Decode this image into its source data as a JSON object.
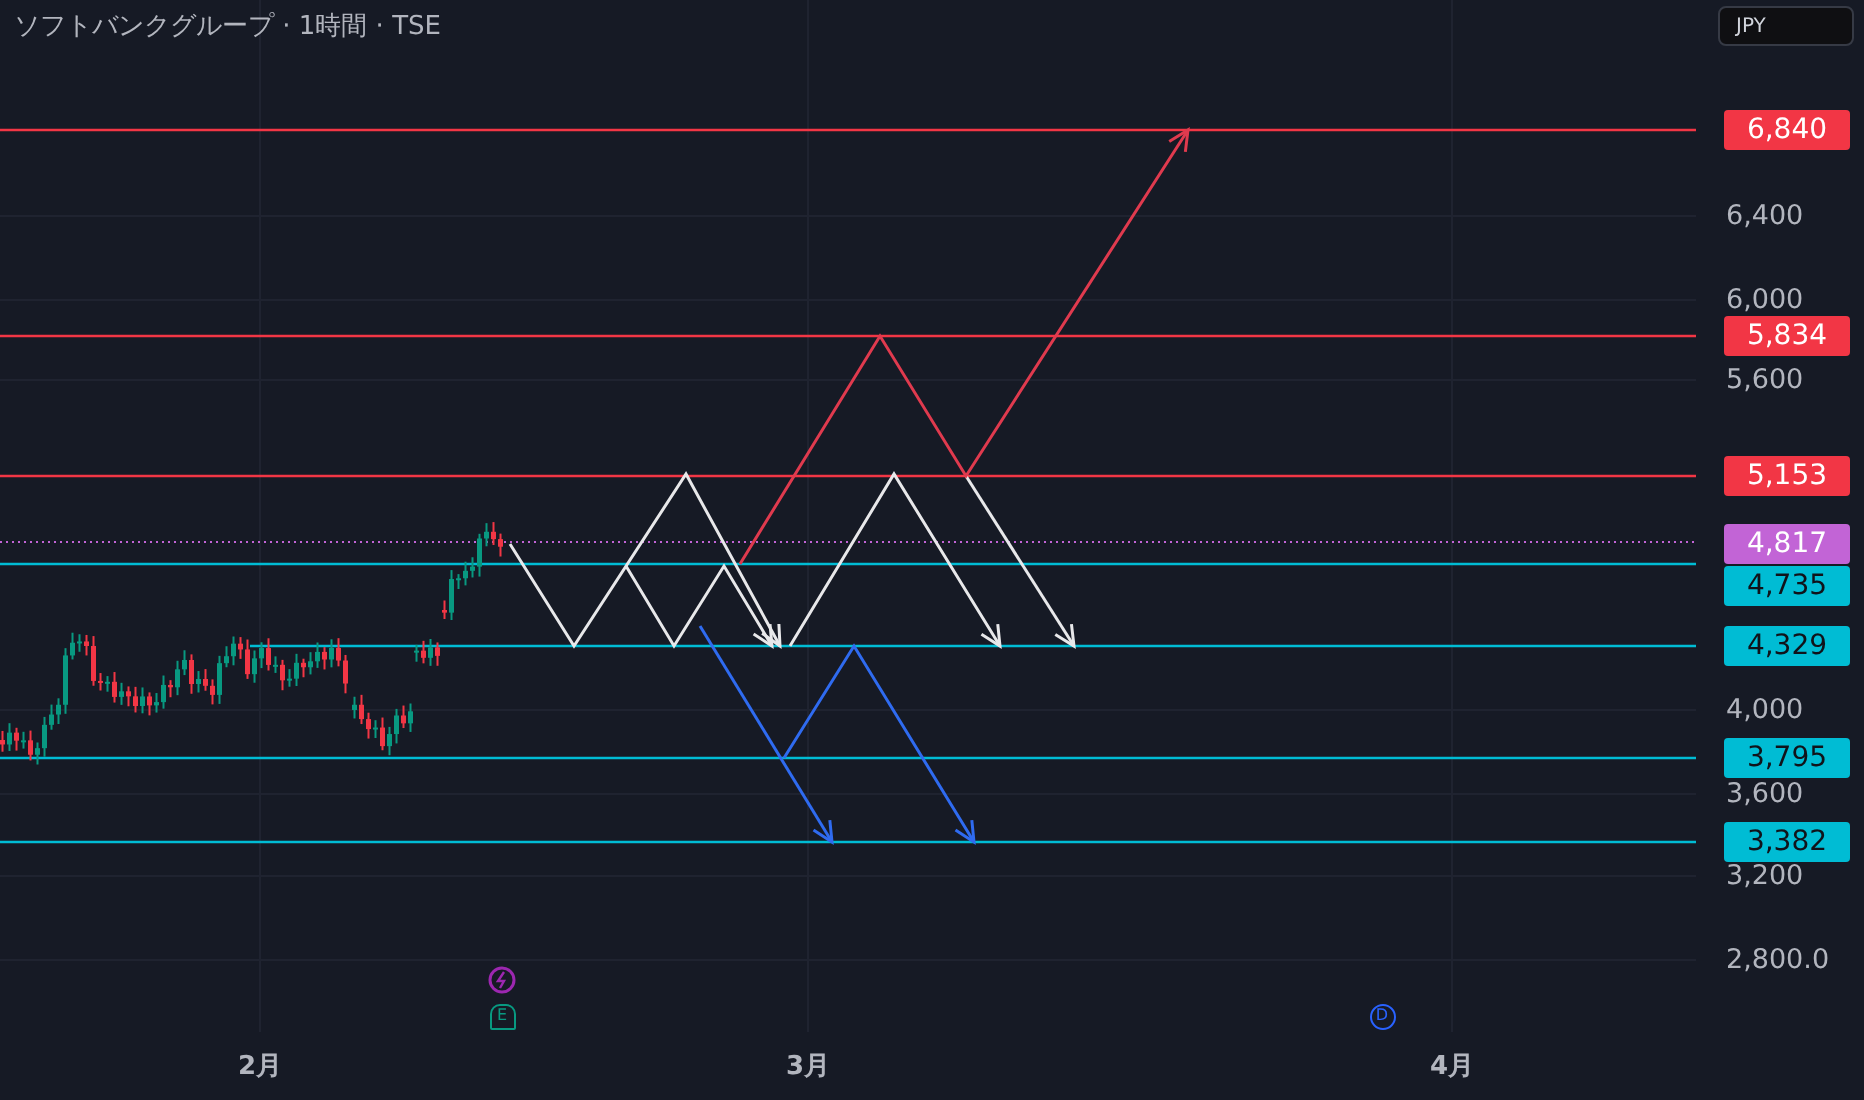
{
  "header": {
    "title": "ソフトバンクグループ · 1時間 · TSE"
  },
  "currency_button": {
    "label": "JPY"
  },
  "price_axis": {
    "ticks": [
      "6,400",
      "6,000",
      "5,600",
      "4,000",
      "3,600",
      "3,200",
      "2,800.0"
    ]
  },
  "levels": [
    {
      "label": "6,840",
      "kind": "resistance",
      "color": "#f23645"
    },
    {
      "label": "5,834",
      "kind": "resistance",
      "color": "#f23645"
    },
    {
      "label": "5,153",
      "kind": "resistance",
      "color": "#f23645"
    },
    {
      "label": "4,817",
      "kind": "last_price",
      "color": "#c264d6"
    },
    {
      "label": "4,735",
      "kind": "support",
      "color": "#00bcd4"
    },
    {
      "label": "4,329",
      "kind": "support",
      "color": "#00bcd4"
    },
    {
      "label": "3,795",
      "kind": "support",
      "color": "#00bcd4"
    },
    {
      "label": "3,382",
      "kind": "support",
      "color": "#00bcd4"
    }
  ],
  "events": [
    {
      "kind": "split",
      "color": "#9c27b0"
    },
    {
      "kind": "earnings",
      "label": "E",
      "color": "#089981"
    },
    {
      "kind": "dividend",
      "label": "D",
      "color": "#2962ff"
    }
  ],
  "time_axis": {
    "labels": [
      "2月",
      "3月",
      "4月"
    ]
  }
}
